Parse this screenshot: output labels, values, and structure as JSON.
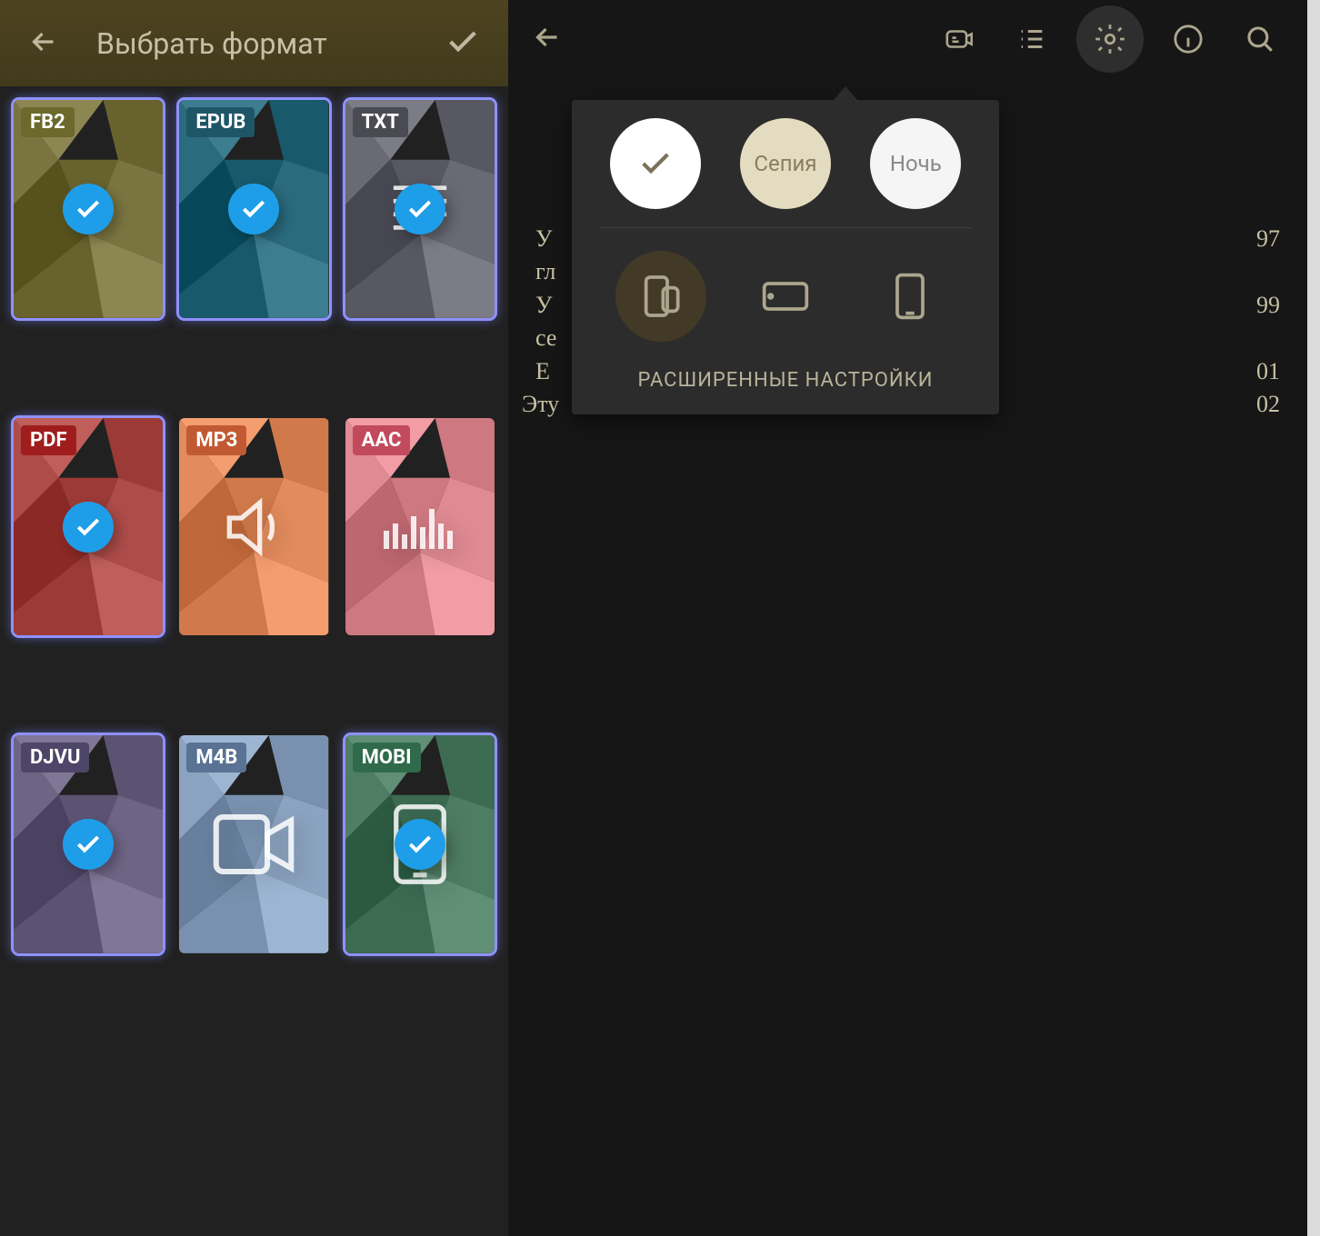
{
  "left": {
    "title": "Выбрать формат",
    "formats": [
      {
        "label": "FB2",
        "badgeColor": "#6b6a2c",
        "bg": "#7a7540",
        "selected": true,
        "icon": "none"
      },
      {
        "label": "EPUB",
        "badgeColor": "#1e5668",
        "bg": "#2a6b7d",
        "selected": true,
        "icon": "none"
      },
      {
        "label": "TXT",
        "badgeColor": "#4a4a52",
        "bg": "#6a6a74",
        "selected": true,
        "icon": "lines"
      },
      {
        "label": "PDF",
        "badgeColor": "#a01d1d",
        "bg": "#ad4c49",
        "selected": true,
        "icon": "none"
      },
      {
        "label": "MP3",
        "badgeColor": "#c15a33",
        "bg": "#e28b5d",
        "selected": false,
        "icon": "speaker"
      },
      {
        "label": "AAC",
        "badgeColor": "#c24a5d",
        "bg": "#e08a93",
        "selected": false,
        "icon": "eq"
      },
      {
        "label": "DJVU",
        "badgeColor": "#4e4668",
        "bg": "#6e6585",
        "selected": true,
        "icon": "none"
      },
      {
        "label": "M4B",
        "badgeColor": "#5a7294",
        "bg": "#8ba3c0",
        "selected": false,
        "icon": "video"
      },
      {
        "label": "MOBI",
        "badgeColor": "#2f6b4a",
        "bg": "#4e7d64",
        "selected": true,
        "icon": "phone"
      }
    ]
  },
  "right": {
    "popup": {
      "themes": {
        "white_selected": true,
        "sepia_label": "Сепия",
        "night_label": "Ночь"
      },
      "orientation_selected": 0,
      "advanced_label": "РАСШИРЕННЫЕ НАСТРОЙКИ"
    },
    "text_fragments": {
      "l1_left": "У",
      "l1_right": "97",
      "l2_left": "гл",
      "l3_left": "У",
      "l3_right": "99",
      "l4_left": "се",
      "l5_left": "Е",
      "l5_right": "01",
      "l6_left": "Эту",
      "l6_right": "02"
    }
  }
}
